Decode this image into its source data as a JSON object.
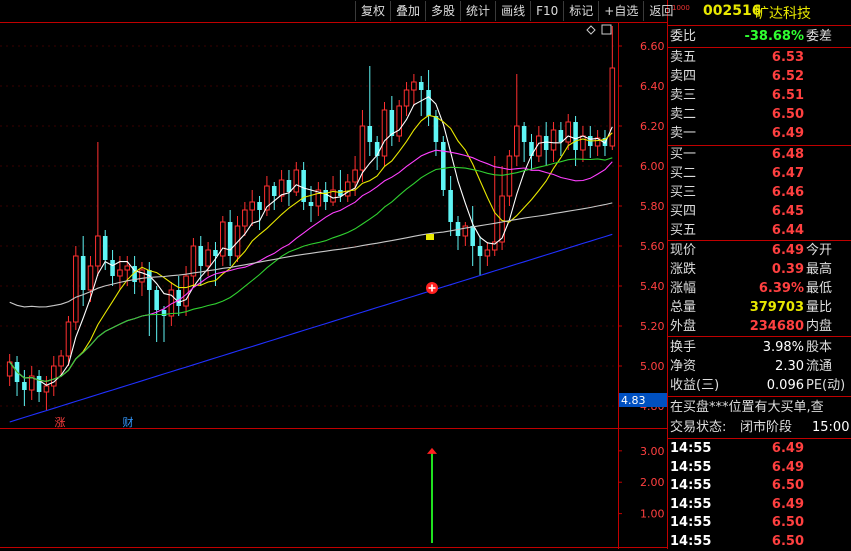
{
  "toolbar": [
    "复权",
    "叠加",
    "多股",
    "统计",
    "画线",
    "F10",
    "标记",
    "+自选",
    "返回"
  ],
  "stock": {
    "code_tag": "1000",
    "code": "002516",
    "name": "旷达科技"
  },
  "weibi": {
    "label": "委比",
    "value": "-38.68%",
    "right": "委差"
  },
  "sells": [
    {
      "label": "卖五",
      "price": "6.53"
    },
    {
      "label": "卖四",
      "price": "6.52"
    },
    {
      "label": "卖三",
      "price": "6.51"
    },
    {
      "label": "卖二",
      "price": "6.50"
    },
    {
      "label": "卖一",
      "price": "6.49"
    }
  ],
  "buys": [
    {
      "label": "买一",
      "price": "6.48"
    },
    {
      "label": "买二",
      "price": "6.47"
    },
    {
      "label": "买三",
      "price": "6.46"
    },
    {
      "label": "买四",
      "price": "6.45"
    },
    {
      "label": "买五",
      "price": "6.44"
    }
  ],
  "stats": [
    {
      "label": "现价",
      "value": "6.49",
      "right": "今开",
      "color": "red"
    },
    {
      "label": "涨跌",
      "value": "0.39",
      "right": "最高",
      "color": "red"
    },
    {
      "label": "涨幅",
      "value": "6.39%",
      "right": "最低",
      "color": "red"
    },
    {
      "label": "总量",
      "value": "379703",
      "right": "量比",
      "color": "yel"
    },
    {
      "label": "外盘",
      "value": "234680",
      "right": "内盘",
      "color": "red"
    }
  ],
  "stats2": [
    {
      "label": "换手",
      "value": "3.98%",
      "right": "股本"
    },
    {
      "label": "净资",
      "value": "2.30",
      "right": "流通"
    },
    {
      "label": "收益(三)",
      "value": "0.096",
      "right": "PE(动)"
    }
  ],
  "notice": "在买盘***位置有大买单,查",
  "trade_state": {
    "label": "交易状态:",
    "value": "闭市阶段",
    "time": "15:00:"
  },
  "ticks": [
    {
      "time": "14:55",
      "price": "6.49"
    },
    {
      "time": "14:55",
      "price": "6.49"
    },
    {
      "time": "14:55",
      "price": "6.50"
    },
    {
      "time": "14:55",
      "price": "6.49"
    },
    {
      "time": "14:55",
      "price": "6.50"
    },
    {
      "time": "14:55",
      "price": "6.50"
    }
  ],
  "chart_data": {
    "type": "candlestick",
    "price_axis": [
      "6.60",
      "6.40",
      "6.20",
      "6.00",
      "5.80",
      "5.60",
      "5.40",
      "5.20",
      "5.00",
      "4.80"
    ],
    "price_range": [
      4.77,
      6.72
    ],
    "current_marker": "4.83",
    "markers": [
      "涨",
      "财"
    ],
    "candles": [
      [
        4.95,
        5.02,
        4.9,
        5.06
      ],
      [
        5.02,
        4.92,
        4.85,
        5.05
      ],
      [
        4.92,
        4.88,
        4.8,
        4.98
      ],
      [
        4.88,
        4.95,
        4.83,
        5.0
      ],
      [
        4.95,
        4.87,
        4.82,
        4.98
      ],
      [
        4.87,
        4.9,
        4.78,
        4.95
      ],
      [
        4.9,
        5.0,
        4.85,
        5.05
      ],
      [
        5.0,
        5.05,
        4.95,
        5.08
      ],
      [
        5.05,
        5.22,
        5.0,
        5.25
      ],
      [
        5.22,
        5.55,
        5.18,
        5.6
      ],
      [
        5.55,
        5.38,
        5.3,
        5.65
      ],
      [
        5.38,
        5.5,
        5.32,
        5.55
      ],
      [
        5.5,
        5.65,
        5.45,
        6.12
      ],
      [
        5.65,
        5.53,
        5.48,
        5.68
      ],
      [
        5.53,
        5.45,
        5.4,
        5.58
      ],
      [
        5.45,
        5.48,
        5.38,
        5.55
      ],
      [
        5.48,
        5.5,
        5.4,
        5.55
      ],
      [
        5.5,
        5.42,
        5.36,
        5.55
      ],
      [
        5.42,
        5.48,
        5.35,
        5.52
      ],
      [
        5.48,
        5.38,
        5.15,
        5.52
      ],
      [
        5.38,
        5.28,
        5.12,
        5.4
      ],
      [
        5.28,
        5.25,
        5.12,
        5.3
      ],
      [
        5.25,
        5.38,
        5.2,
        5.42
      ],
      [
        5.38,
        5.3,
        5.25,
        5.45
      ],
      [
        5.3,
        5.45,
        5.25,
        5.5
      ],
      [
        5.45,
        5.6,
        5.4,
        5.64
      ],
      [
        5.6,
        5.5,
        5.4,
        5.65
      ],
      [
        5.5,
        5.58,
        5.45,
        5.62
      ],
      [
        5.58,
        5.55,
        5.4,
        5.62
      ],
      [
        5.55,
        5.72,
        5.5,
        5.75
      ],
      [
        5.72,
        5.55,
        5.5,
        5.78
      ],
      [
        5.55,
        5.7,
        5.52,
        5.75
      ],
      [
        5.7,
        5.78,
        5.65,
        5.82
      ],
      [
        5.78,
        5.82,
        5.7,
        5.88
      ],
      [
        5.82,
        5.78,
        5.68,
        5.85
      ],
      [
        5.78,
        5.9,
        5.75,
        5.95
      ],
      [
        5.9,
        5.85,
        5.78,
        5.92
      ],
      [
        5.85,
        5.93,
        5.82,
        5.98
      ],
      [
        5.93,
        5.87,
        5.8,
        5.98
      ],
      [
        5.87,
        5.98,
        5.85,
        6.02
      ],
      [
        5.98,
        5.82,
        5.78,
        6.02
      ],
      [
        5.82,
        5.8,
        5.72,
        5.9
      ],
      [
        5.8,
        5.88,
        5.75,
        5.92
      ],
      [
        5.88,
        5.82,
        5.78,
        5.92
      ],
      [
        5.82,
        5.88,
        5.8,
        5.95
      ],
      [
        5.88,
        5.85,
        5.82,
        5.98
      ],
      [
        5.85,
        5.92,
        5.82,
        5.96
      ],
      [
        5.92,
        5.98,
        5.85,
        6.05
      ],
      [
        5.98,
        6.2,
        5.92,
        6.28
      ],
      [
        6.2,
        6.12,
        6.05,
        6.5
      ],
      [
        6.12,
        6.05,
        5.98,
        6.15
      ],
      [
        6.05,
        6.28,
        6.0,
        6.32
      ],
      [
        6.28,
        6.15,
        6.1,
        6.35
      ],
      [
        6.15,
        6.3,
        6.12,
        6.33
      ],
      [
        6.3,
        6.38,
        6.25,
        6.42
      ],
      [
        6.38,
        6.42,
        6.3,
        6.46
      ],
      [
        6.42,
        6.38,
        6.25,
        6.45
      ],
      [
        6.38,
        6.25,
        6.2,
        6.48
      ],
      [
        6.25,
        6.12,
        6.05,
        6.28
      ],
      [
        6.12,
        5.88,
        5.85,
        6.15
      ],
      [
        5.88,
        5.72,
        5.65,
        5.95
      ],
      [
        5.72,
        5.65,
        5.58,
        5.75
      ],
      [
        5.65,
        5.7,
        5.6,
        5.72
      ],
      [
        5.7,
        5.6,
        5.5,
        5.8
      ],
      [
        5.6,
        5.55,
        5.45,
        5.65
      ],
      [
        5.55,
        5.58,
        5.5,
        5.62
      ],
      [
        5.58,
        5.62,
        5.55,
        6.05
      ],
      [
        5.62,
        5.85,
        5.58,
        6.0
      ],
      [
        5.85,
        6.05,
        5.8,
        6.08
      ],
      [
        6.05,
        6.2,
        6.0,
        6.46
      ],
      [
        6.2,
        6.12,
        6.02,
        6.22
      ],
      [
        6.12,
        6.05,
        5.98,
        6.16
      ],
      [
        6.05,
        6.15,
        6.02,
        6.2
      ],
      [
        6.15,
        6.08,
        6.0,
        6.22
      ],
      [
        6.08,
        6.18,
        6.02,
        6.22
      ],
      [
        6.18,
        6.12,
        6.05,
        6.22
      ],
      [
        6.12,
        6.22,
        6.08,
        6.26
      ],
      [
        6.22,
        6.08,
        6.0,
        6.25
      ],
      [
        6.08,
        6.15,
        6.02,
        6.2
      ],
      [
        6.15,
        6.1,
        6.04,
        6.2
      ],
      [
        6.1,
        6.14,
        6.05,
        6.18
      ],
      [
        6.14,
        6.1,
        6.05,
        6.18
      ],
      [
        6.1,
        6.49,
        6.08,
        6.7
      ]
    ],
    "volume_axis": [
      "3.00",
      "2.00",
      "1.00"
    ],
    "volume_signal": 3.0
  }
}
